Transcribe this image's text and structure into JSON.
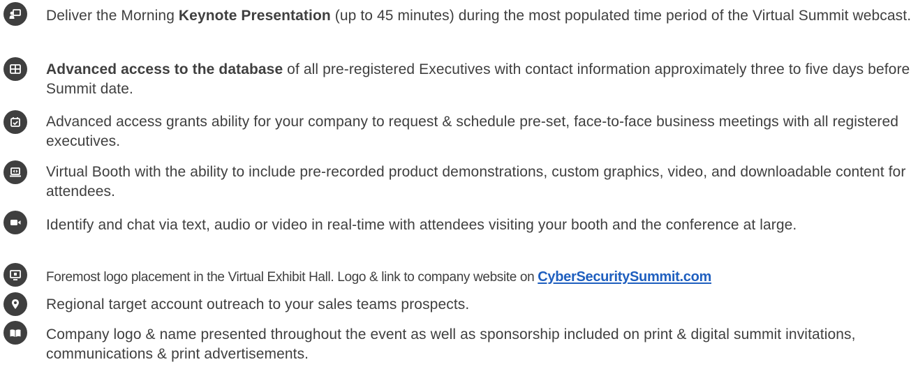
{
  "benefits": [
    {
      "icon": "presenter-icon",
      "pre": "Deliver the Morning ",
      "bold": "Keynote Presentation",
      "post": " (up to 45 minutes) during the most populated time period of the Virtual Summit webcast."
    },
    {
      "icon": "database-grid-icon",
      "bold": "Advanced access to the database",
      "post": " of all pre-registered Executives with contact information approximately three to five days before Summit date."
    },
    {
      "icon": "calendar-check-icon",
      "text": "Advanced access grants ability for your company to request & schedule pre-set, face-to-face business meetings with all registered executives."
    },
    {
      "icon": "laptop-booth-icon",
      "text": "Virtual Booth with the ability to include pre-recorded product demonstrations, custom graphics, video, and downloadable content for attendees."
    },
    {
      "icon": "video-camera-icon",
      "text": "Identify and chat via text, audio or video in real-time with attendees visiting your booth and the conference at large."
    },
    {
      "icon": "monitor-logo-icon",
      "text": "Foremost logo placement in the Virtual Exhibit Hall. Logo & link to company website on ",
      "link": "CyberSecuritySummit.com"
    },
    {
      "icon": "map-pin-icon",
      "text": "Regional target account outreach to your sales teams prospects."
    },
    {
      "icon": "open-book-icon",
      "text": "Company logo & name presented throughout the event as well as sponsorship included on print & digital summit invitations, communications & print advertisements."
    }
  ]
}
